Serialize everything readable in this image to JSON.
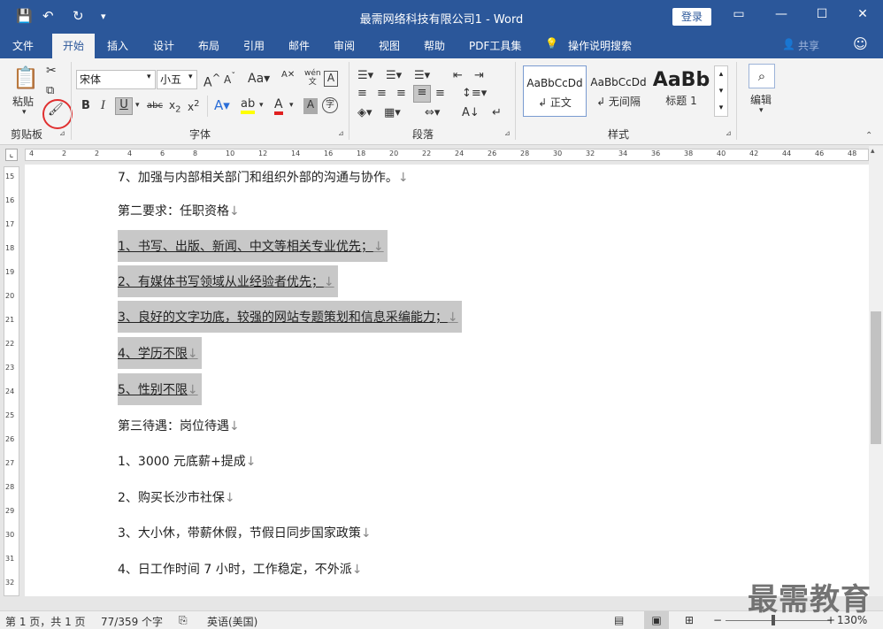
{
  "window": {
    "title": "最需网络科技有限公司1 - Word",
    "login": "登录",
    "share": "共享"
  },
  "quick_access": [
    "save-icon",
    "undo-icon",
    "redo-icon",
    "customize-icon"
  ],
  "tabs": [
    "文件",
    "开始",
    "插入",
    "设计",
    "布局",
    "引用",
    "邮件",
    "审阅",
    "视图",
    "帮助",
    "PDF工具集"
  ],
  "tell_me": "操作说明搜索",
  "clipboard": {
    "paste": "粘贴",
    "group": "剪贴板"
  },
  "font": {
    "name": "宋体",
    "size": "小五",
    "group": "字体"
  },
  "paragraph": {
    "group": "段落"
  },
  "styles": {
    "group": "样式",
    "items": [
      {
        "preview": "AaBbCcDd",
        "name": "↲ 正文"
      },
      {
        "preview": "AaBbCcDd",
        "name": "↲ 无间隔"
      },
      {
        "preview": "AaBb",
        "name": "标题 1"
      }
    ]
  },
  "editing": {
    "label": "编辑"
  },
  "ruler": {
    "marks": [
      "4",
      "2",
      "2",
      "4",
      "6",
      "8",
      "10",
      "12",
      "14",
      "16",
      "18",
      "20",
      "22",
      "24",
      "26",
      "28",
      "30",
      "32",
      "34",
      "36",
      "38",
      "40",
      "42",
      "44",
      "46",
      "48"
    ]
  },
  "vruler": {
    "marks": [
      "15",
      "16",
      "17",
      "18",
      "19",
      "20",
      "21",
      "22",
      "23",
      "24",
      "25",
      "26",
      "27",
      "28",
      "29",
      "30",
      "31",
      "32"
    ]
  },
  "document": {
    "lines": [
      {
        "text": "7、加强与内部相关部门和组织外部的沟通与协作。",
        "sel": false
      },
      {
        "text": "第二要求：任职资格",
        "sel": false
      },
      {
        "text": "1、书写、出版、新闻、中文等相关专业优先；",
        "sel": true
      },
      {
        "text": "2、有媒体书写领域从业经验者优先；",
        "sel": true
      },
      {
        "text": "3、良好的文字功底，较强的网站专题策划和信息采编能力；",
        "sel": true
      },
      {
        "text": "4、学历不限",
        "sel": true
      },
      {
        "text": "5、性别不限",
        "sel": true
      },
      {
        "text": "第三待遇：岗位待遇",
        "sel": false
      },
      {
        "text": "1、3000 元底薪+提成",
        "sel": false
      },
      {
        "text": "2、购买长沙市社保",
        "sel": false
      },
      {
        "text": "3、大小休，带薪休假，节假日同步国家政策",
        "sel": false
      },
      {
        "text": "4、日工作时间 7 小时，工作稳定，不外派",
        "sel": false
      }
    ],
    "para_mark": "↓"
  },
  "status": {
    "page": "第 1 页，共 1 页",
    "words": "77/359 个字",
    "language": "英语(美国)",
    "zoom": "130%"
  },
  "watermark": "最需教育"
}
